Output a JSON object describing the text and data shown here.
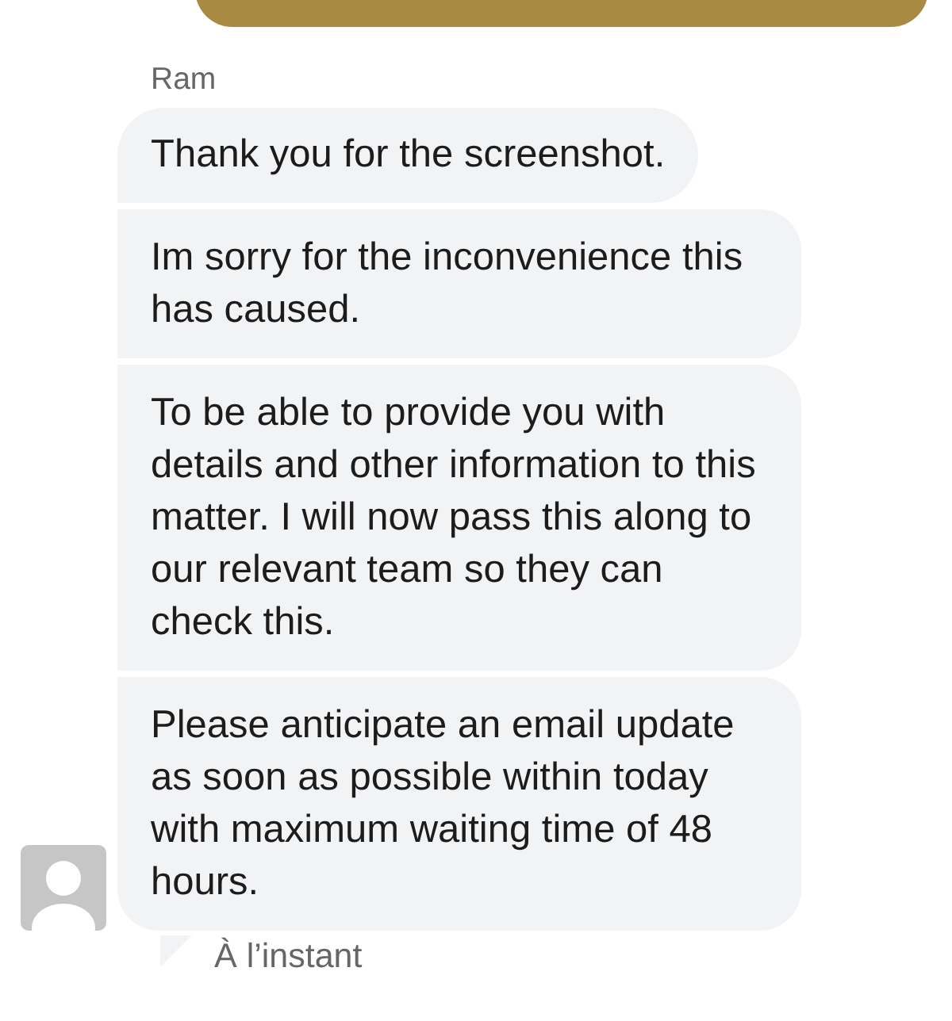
{
  "previous_message": {
    "kind": "outgoing"
  },
  "conversation": {
    "sender": "Ram",
    "messages": [
      "Thank you for the screenshot.",
      "Im sorry for the inconvenience this has caused.",
      "To be able to provide you with details and other information to this matter. I will now pass this along to our relevant team so they can check this.",
      "Please anticipate an email update as soon as possible within today with maximum waiting time of 48 hours."
    ],
    "timestamp": "À l’instant"
  }
}
